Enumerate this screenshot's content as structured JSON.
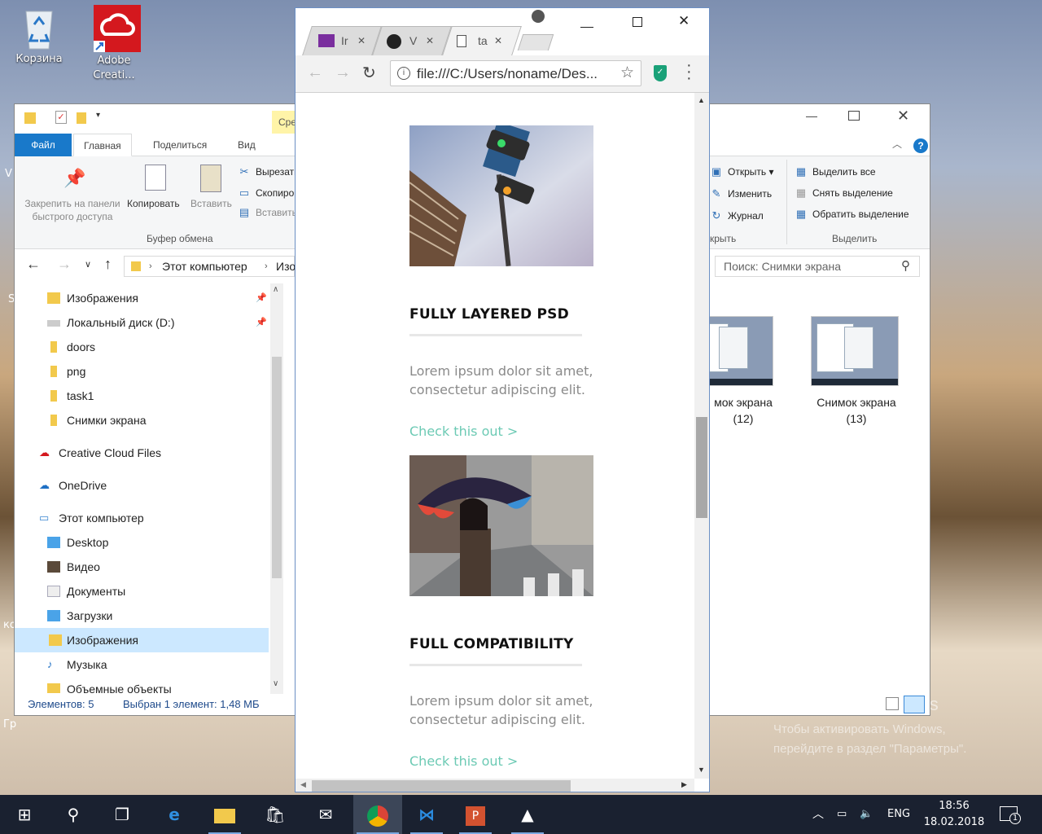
{
  "desktop": {
    "icons": [
      {
        "label": "Корзина",
        "icon": "recycle-bin-icon"
      },
      {
        "label": "Adobe Creati...",
        "icon": "adobe-cc-icon"
      }
    ],
    "watermark": {
      "title": "Активация Windows",
      "line1": "Чтобы активировать Windows,",
      "line2": "перейдите в раздел \"Параметры\"."
    },
    "edge_text": {
      "left1": "V",
      "left2": "S",
      "left3": "ко",
      "left4": "Гр"
    }
  },
  "explorer": {
    "ribbon_context_tab": "Сре",
    "tabs": [
      "Файл",
      "Главная",
      "Поделиться",
      "Вид"
    ],
    "clipboard": {
      "pin": "Закрепить на панели быстрого доступа",
      "copy": "Копировать",
      "paste": "Вставить",
      "cut": "Вырезать",
      "copy_path": "Скопировать",
      "paste_shortcut": "Вставить",
      "group": "Буфер обмена"
    },
    "open_group": {
      "open": "Открыть",
      "edit": "Изменить",
      "history": "Журнал",
      "group": "Открыть",
      "group_visible": "крыть"
    },
    "select_group": {
      "select_all": "Выделить все",
      "select_none": "Снять выделение",
      "invert": "Обратить выделение",
      "group": "Выделить"
    },
    "address": {
      "path1": "Этот компьютер",
      "path2": "Изо"
    },
    "search_placeholder": "Поиск: Снимки экрана",
    "nav": [
      {
        "label": "Изображения",
        "pinned": true
      },
      {
        "label": "Локальный диск (D:)",
        "pinned": true
      },
      {
        "label": "doors"
      },
      {
        "label": "png"
      },
      {
        "label": "task1"
      },
      {
        "label": "Снимки экрана"
      },
      {
        "label": "Creative Cloud Files"
      },
      {
        "label": "OneDrive"
      },
      {
        "label": "Этот компьютер"
      },
      {
        "label": "Desktop"
      },
      {
        "label": "Видео"
      },
      {
        "label": "Документы"
      },
      {
        "label": "Загрузки"
      },
      {
        "label": "Изображения",
        "selected": true
      },
      {
        "label": "Музыка"
      },
      {
        "label": "Объемные объекты"
      }
    ],
    "files": [
      {
        "caption1": "мок экрана",
        "caption2": "(12)"
      },
      {
        "caption1": "Снимок экрана",
        "caption2": "(13)"
      }
    ],
    "status": {
      "count": "Элементов: 5",
      "selected": "Выбран 1 элемент: 1,48 МБ"
    }
  },
  "chrome": {
    "tabs": [
      {
        "label": "Ir",
        "icon": "mail-icon"
      },
      {
        "label": "V",
        "icon": "github-icon"
      },
      {
        "label": "ta",
        "icon": "page-icon",
        "active": true
      }
    ],
    "url": "file:///C:/Users/noname/Des...",
    "cards": [
      {
        "title": "FULLY LAYERED PSD",
        "text": "Lorem ipsum dolor sit amet, consectetur adipiscing elit.",
        "link": "Check this out >",
        "image": "traffic-light-photo"
      },
      {
        "title": "FULL COMPATIBILITY",
        "text": "Lorem ipsum dolor sit amet, consectetur adipiscing elit.",
        "link": "Check this out >",
        "image": "umbrella-girl-photo"
      }
    ],
    "accent": "#6ccab4"
  },
  "taskbar": {
    "lang": "ENG",
    "time": "18:56",
    "date": "18.02.2018",
    "notifications": "1"
  }
}
